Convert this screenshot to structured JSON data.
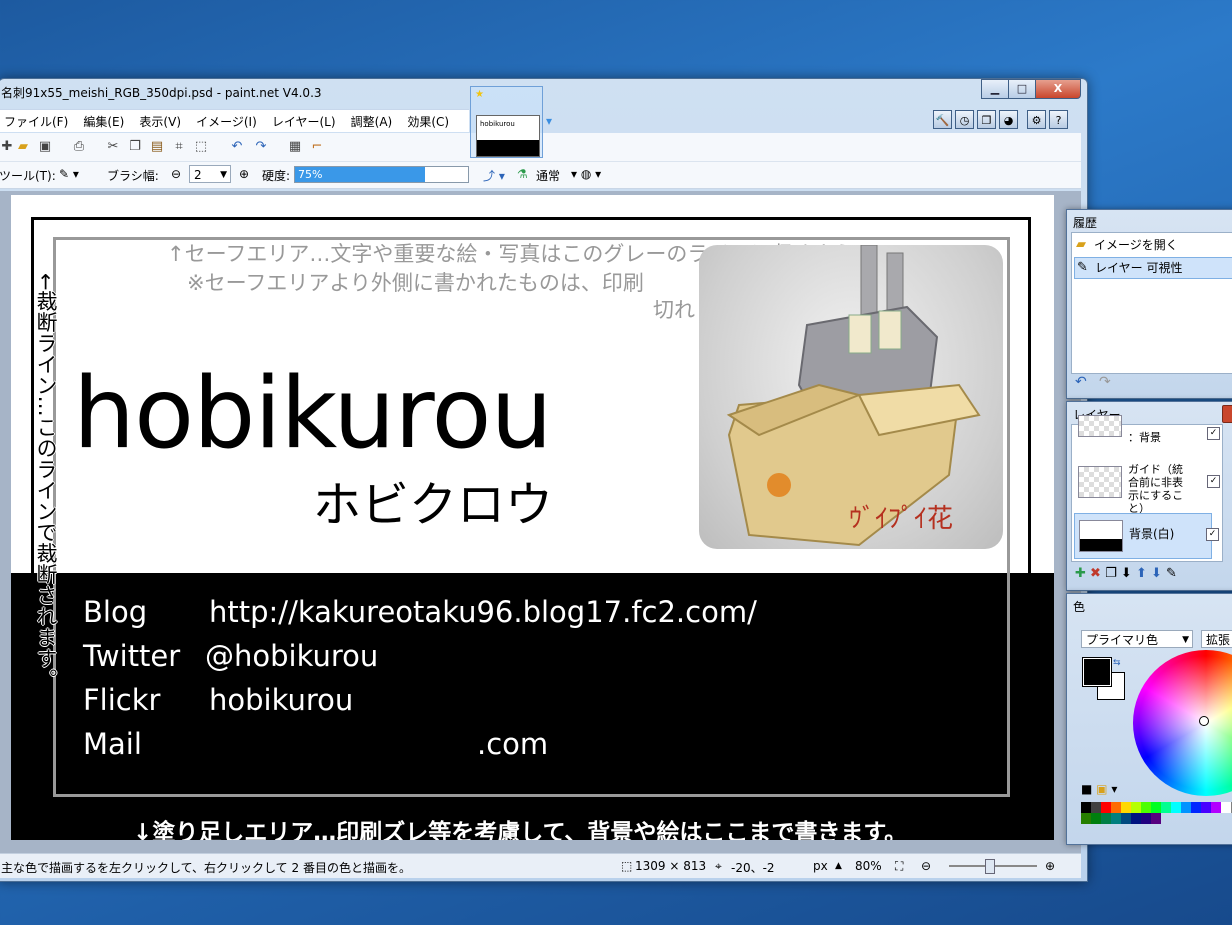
{
  "window": {
    "title": "名刺91x55_meishi_RGB_350dpi.psd - paint.net V4.0.3",
    "controls": {
      "minimize": "▁",
      "maximize": "□",
      "close": "X"
    }
  },
  "menu": [
    "ファイル(F)",
    "編集(E)",
    "表示(V)",
    "イメージ(I)",
    "レイヤー(L)",
    "調整(A)",
    "効果(C)"
  ],
  "toolbar2": {
    "tool_label": "ツール(T):",
    "brush_label": "ブラシ幅:",
    "brush_value": "2",
    "hardness_label": "硬度:",
    "hardness_value": "75%",
    "hardness_fraction": 0.75,
    "blend_mode": "通常"
  },
  "thumbnail": {
    "label": "hobikurou"
  },
  "card": {
    "safe_note1": "↑セーフエリア…文字や重要な絵・写真はこのグレ",
    "safe_note1b": "ーのラインに収めよう",
    "safe_note2": "※セーフエリアより外側に書かれたものは、印刷",
    "safe_note3": "切れ",
    "cut_note": "←裁断ライン…このラインで裁断されます。",
    "name": "hobikurou",
    "kana": "ホビクロウ",
    "box_text": "ｳﾞｲﾌﾟｲ花",
    "contacts": [
      {
        "label": "Blog",
        "value": "http://kakureotaku96.blog17.fc2.com/"
      },
      {
        "label": "Twitter",
        "value": "@hobikurou"
      },
      {
        "label": "Flickr",
        "value": "hobikurou"
      },
      {
        "label": "Mail",
        "value": ".com"
      }
    ],
    "bleed_note": "↓塗り足しエリア…印刷ズレ等を考慮して、背景や絵はここまで書きます。"
  },
  "status": {
    "hint": "主な色で描画するを左クリックして、右クリックして 2 番目の色と描画を。",
    "size": "1309 × 813",
    "cursor": "-20、-2",
    "unit": "px",
    "zoom": "80%"
  },
  "history": {
    "title": "履歴",
    "items": [
      "イメージを開く",
      "レイヤー 可視性"
    ]
  },
  "layers": {
    "title": "レイヤー",
    "items": [
      {
        "name": "：背景",
        "visible": true
      },
      {
        "name": "ガイド（統合前に非表示にすること）",
        "visible": true
      },
      {
        "name": "背景(白)",
        "visible": true
      }
    ]
  },
  "colors": {
    "title": "色",
    "mode": "プライマリ色",
    "expand": "拡張",
    "primary": "#000000",
    "secondary": "#ffffff"
  }
}
